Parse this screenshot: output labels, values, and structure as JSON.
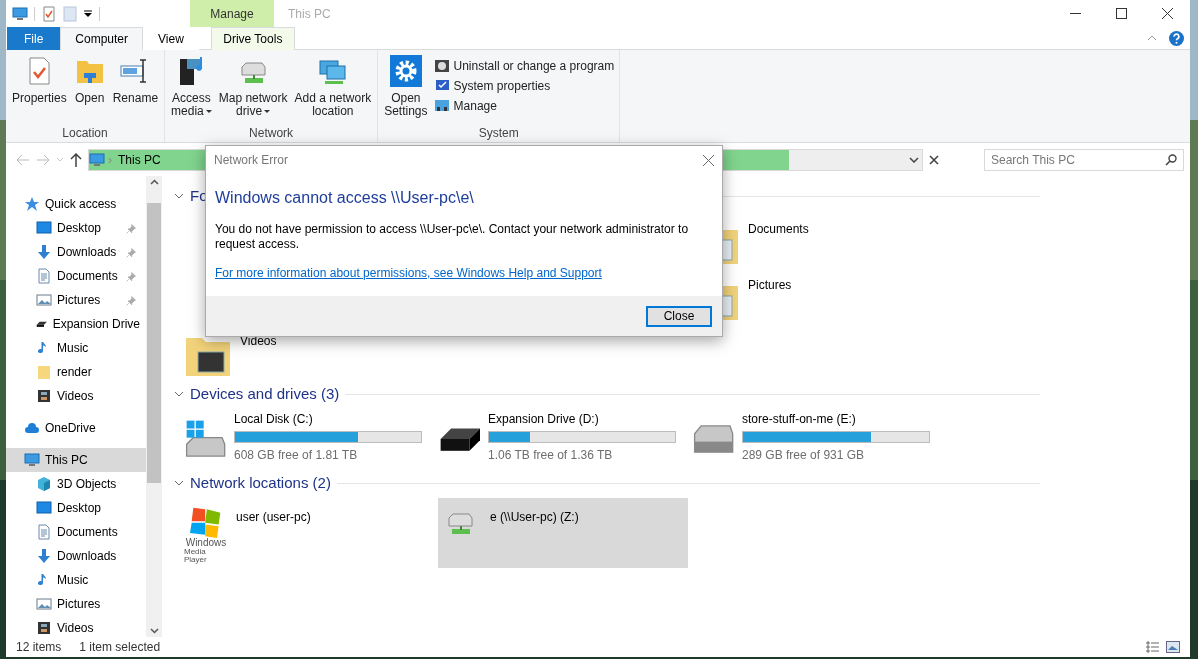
{
  "window": {
    "title": "This PC",
    "context_tab": "Manage"
  },
  "tabs": [
    {
      "label": "File",
      "kind": "file",
      "selected": false
    },
    {
      "label": "Computer",
      "kind": "tab",
      "selected": true
    },
    {
      "label": "View",
      "kind": "tab",
      "selected": false
    },
    {
      "label": "Drive Tools",
      "kind": "context",
      "selected": false
    }
  ],
  "ribbon": {
    "groups": [
      {
        "label": "Location",
        "buttons": [
          {
            "label": "Properties",
            "kind": "properties",
            "menu": false
          },
          {
            "label": "Open",
            "kind": "open",
            "menu": false
          },
          {
            "label": "Rename",
            "kind": "rename",
            "menu": false
          }
        ]
      },
      {
        "label": "Network",
        "buttons": [
          {
            "label": "Access media",
            "kind": "media",
            "menu": true
          },
          {
            "label": "Map network drive",
            "kind": "netdrive",
            "menu": true
          },
          {
            "label": "Add a network location",
            "kind": "netloc",
            "menu": false
          }
        ]
      },
      {
        "label": "System",
        "buttons": [
          {
            "label": "Open Settings",
            "kind": "settings",
            "menu": false
          }
        ],
        "small_buttons": [
          {
            "label": "Uninstall or change a program",
            "kind": "uninstall"
          },
          {
            "label": "System properties",
            "kind": "sysprops"
          },
          {
            "label": "Manage",
            "kind": "manage"
          }
        ]
      }
    ]
  },
  "address": {
    "separator": "›",
    "path": "This PC",
    "level": 0.84,
    "search_placeholder": "Search This PC"
  },
  "sidebar": {
    "items": [
      {
        "label": "Quick access",
        "kind": "star",
        "selected": false,
        "children": [
          {
            "label": "Desktop",
            "kind": "desktop",
            "pinned": true,
            "selected": false
          },
          {
            "label": "Downloads",
            "kind": "download",
            "pinned": true,
            "selected": false
          },
          {
            "label": "Documents",
            "kind": "document",
            "pinned": true,
            "selected": false
          },
          {
            "label": "Pictures",
            "kind": "pictures",
            "pinned": true,
            "selected": false
          },
          {
            "label": "Expansion Drive",
            "kind": "blackdrive",
            "pinned": false,
            "selected": false
          },
          {
            "label": "Music",
            "kind": "music",
            "pinned": false,
            "selected": false
          },
          {
            "label": "render",
            "kind": "folder",
            "pinned": false,
            "selected": false
          },
          {
            "label": "Videos",
            "kind": "videos",
            "pinned": false,
            "selected": false
          }
        ]
      },
      {
        "label": "OneDrive",
        "kind": "cloud",
        "selected": false
      },
      {
        "label": "This PC",
        "kind": "monitor",
        "selected": true,
        "children": [
          {
            "label": "3D Objects",
            "kind": "cube",
            "pinned": false,
            "selected": false
          },
          {
            "label": "Desktop",
            "kind": "desktop",
            "pinned": false,
            "selected": false
          },
          {
            "label": "Documents",
            "kind": "document",
            "pinned": false,
            "selected": false
          },
          {
            "label": "Downloads",
            "kind": "download",
            "pinned": false,
            "selected": false
          },
          {
            "label": "Music",
            "kind": "music",
            "pinned": false,
            "selected": false
          },
          {
            "label": "Pictures",
            "kind": "pictures",
            "pinned": false,
            "selected": false
          },
          {
            "label": "Videos",
            "kind": "videos",
            "pinned": false,
            "selected": false
          }
        ]
      }
    ]
  },
  "sections": [
    {
      "title": "Fo",
      "kind": "folders",
      "items": [
        {
          "label": "Documents",
          "kind": "document"
        },
        {
          "label": "Pictures",
          "kind": "pictures"
        },
        {
          "label": "Videos",
          "kind": "videos"
        }
      ]
    },
    {
      "title": "Devices and drives (3)",
      "kind": "drives",
      "items": [
        {
          "label": "Local Disk (C:)",
          "kind": "windisk",
          "level": 0.66,
          "free": "608 GB free of 1.81 TB"
        },
        {
          "label": "Expansion Drive (D:)",
          "kind": "blackdrive",
          "level": 0.22,
          "free": "1.06 TB free of 1.36 TB"
        },
        {
          "label": "store-stuff-on-me (E:)",
          "kind": "disk",
          "level": 0.69,
          "free": "289 GB free of 931 GB"
        }
      ]
    },
    {
      "title": "Network locations (2)",
      "kind": "network",
      "items": [
        {
          "label": "user (user-pc)",
          "kind": "mediaplayer",
          "logo_lines": [
            "Windows",
            "Media Player"
          ],
          "selected": false
        },
        {
          "label": "e (\\\\User-pc) (Z:)",
          "kind": "netdrive",
          "selected": true
        }
      ]
    }
  ],
  "status_bar": {
    "count": "12 items",
    "selection": "1 item selected"
  },
  "dialog": {
    "title": "Network Error",
    "heading": "Windows cannot access \\\\User-pc\\e\\",
    "message": "You do not have permission to access \\\\User-pc\\e\\. Contact your network administrator to request access.",
    "link": "For more information about permissions, see Windows Help and Support",
    "button": "Close"
  }
}
